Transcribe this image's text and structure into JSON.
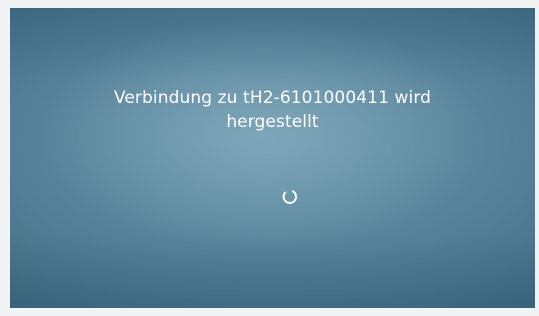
{
  "dialog": {
    "message_line1": "Verbindung zu tH2-6101000411 wird",
    "message_line2": "hergestellt"
  },
  "spinner": {
    "icon": "loading-spinner-icon",
    "color": "#ffffff"
  },
  "colors": {
    "background": "#57839a",
    "text": "#ffffff"
  }
}
